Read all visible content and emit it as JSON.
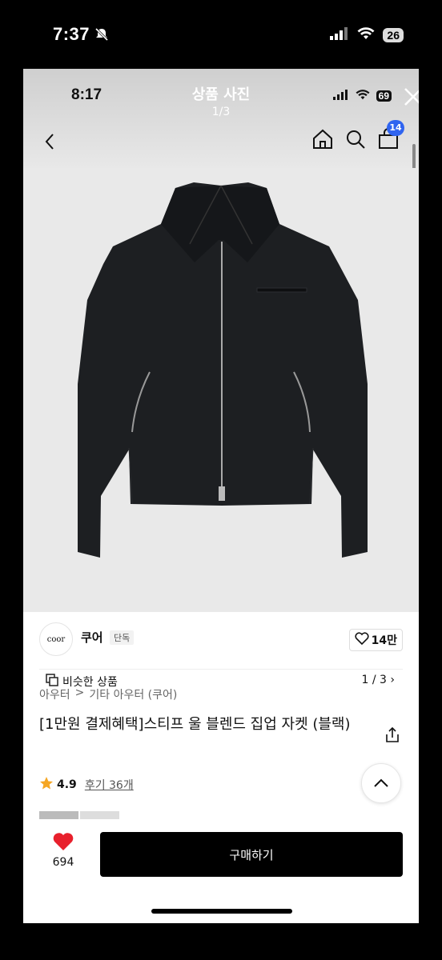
{
  "outer_status": {
    "time": "7:37",
    "battery": "26"
  },
  "viewer": {
    "title": "상품 사진",
    "index": "1/3"
  },
  "inner_status": {
    "time": "8:17",
    "battery": "69"
  },
  "header": {
    "cart_count": "14"
  },
  "gallery": {
    "similar_label": "비슷한 상품",
    "page": "1 / 3",
    "next_icon": "chevron-right-icon"
  },
  "brand": {
    "logo_text": "coor",
    "name": "쿠어",
    "badge": "단독",
    "likes": "14만"
  },
  "breadcrumb": {
    "category": "아우터",
    "separator": ">",
    "subcategory": "기타 아우터 (쿠어)"
  },
  "product": {
    "title": "[1만원 결제혜택]스티프 울 블렌드 집업 자켓 (블랙)"
  },
  "rating": {
    "score": "4.9",
    "reviews": "후기 36개"
  },
  "bottom": {
    "wish_count": "694",
    "buy_label": "구매하기"
  },
  "colors": {
    "accent": "#2f64f0",
    "heart": "#e8202c",
    "star": "#f5a623",
    "buy": "#000000"
  }
}
